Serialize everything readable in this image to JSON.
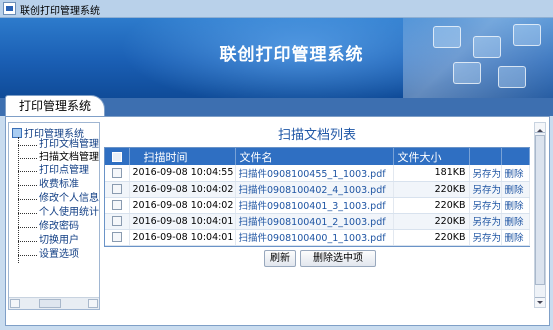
{
  "window": {
    "title": "联创打印管理系统"
  },
  "banner": {
    "title": "联创打印管理系统"
  },
  "tab": {
    "label": "打印管理系统"
  },
  "tree": {
    "root": "打印管理系统",
    "items": [
      {
        "label": "打印文档管理"
      },
      {
        "label": "扫描文档管理"
      },
      {
        "label": "打印点管理"
      },
      {
        "label": "收费标准"
      },
      {
        "label": "修改个人信息"
      },
      {
        "label": "个人使用统计"
      },
      {
        "label": "修改密码"
      },
      {
        "label": "切换用户"
      },
      {
        "label": "设置选项"
      }
    ]
  },
  "list": {
    "title": "扫描文档列表",
    "columns": {
      "time": "扫描时间",
      "name": "文件名",
      "size": "文件大小"
    },
    "rows": [
      {
        "time": "2016-09-08 10:04:55",
        "name": "扫描件0908100455_1_1003.pdf",
        "size": "181KB",
        "save": "另存为",
        "delete": "删除"
      },
      {
        "time": "2016-09-08 10:04:02",
        "name": "扫描件0908100402_4_1003.pdf",
        "size": "220KB",
        "save": "另存为",
        "delete": "删除"
      },
      {
        "time": "2016-09-08 10:04:02",
        "name": "扫描件0908100401_3_1003.pdf",
        "size": "220KB",
        "save": "另存为",
        "delete": "删除"
      },
      {
        "time": "2016-09-08 10:04:01",
        "name": "扫描件0908100401_2_1003.pdf",
        "size": "220KB",
        "save": "另存为",
        "delete": "删除"
      },
      {
        "time": "2016-09-08 10:04:01",
        "name": "扫描件0908100400_1_1003.pdf",
        "size": "220KB",
        "save": "另存为",
        "delete": "删除"
      }
    ]
  },
  "buttons": {
    "refresh": "刷新",
    "delete_selected": "删除选中项"
  },
  "colors": {
    "header_blue": "#2f6fc2",
    "banner_blue": "#1a5eb3",
    "link_blue": "#1f55a3"
  }
}
